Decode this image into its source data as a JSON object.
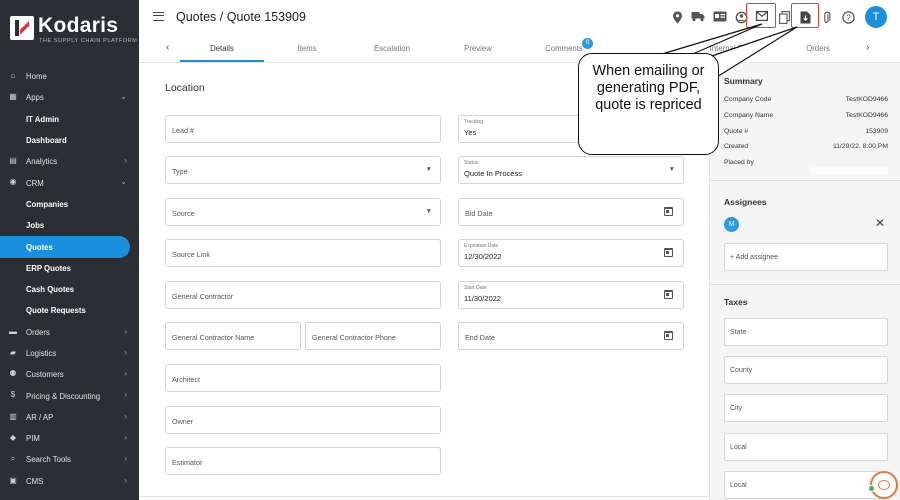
{
  "brand": {
    "name": "Kodaris",
    "tagline": "THE SUPPLY CHAIN PLATFORM"
  },
  "sidebar": {
    "items": [
      {
        "label": "Home",
        "icon": "home-icon",
        "glyph": "⌂",
        "has_chevron": false,
        "sub": false
      },
      {
        "label": "Apps",
        "icon": "apps-grid-icon",
        "glyph": "▦",
        "has_chevron": true,
        "chevron": "⌄",
        "sub": false
      },
      {
        "label": "IT Admin",
        "sub": true
      },
      {
        "label": "Dashboard",
        "sub": true
      },
      {
        "label": "Analytics",
        "icon": "analytics-icon",
        "glyph": "▤",
        "has_chevron": true,
        "chevron": "›",
        "sub": false
      },
      {
        "label": "CRM",
        "icon": "crm-icon",
        "glyph": "◉",
        "has_chevron": true,
        "chevron": "⌄",
        "sub": false
      },
      {
        "label": "Companies",
        "sub": true
      },
      {
        "label": "Jobs",
        "sub": true
      },
      {
        "label": "Quotes",
        "sub": true,
        "active": true
      },
      {
        "label": "ERP Quotes",
        "sub": true
      },
      {
        "label": "Cash Quotes",
        "sub": true
      },
      {
        "label": "Quote Requests",
        "sub": true
      },
      {
        "label": "Orders",
        "icon": "orders-icon",
        "glyph": "▬",
        "has_chevron": true,
        "chevron": "›",
        "sub": false
      },
      {
        "label": "Logistics",
        "icon": "truck-icon",
        "glyph": "▰",
        "has_chevron": true,
        "chevron": "›",
        "sub": false
      },
      {
        "label": "Customers",
        "icon": "people-icon",
        "glyph": "⚉",
        "has_chevron": true,
        "chevron": "›",
        "sub": false
      },
      {
        "label": "Pricing & Discounting",
        "icon": "dollar-icon",
        "glyph": "$",
        "has_chevron": true,
        "chevron": "›",
        "sub": false
      },
      {
        "label": "AR / AP",
        "icon": "bank-icon",
        "glyph": "▥",
        "has_chevron": true,
        "chevron": "›",
        "sub": false
      },
      {
        "label": "PIM",
        "icon": "tag-icon",
        "glyph": "◆",
        "has_chevron": true,
        "chevron": "›",
        "sub": false
      },
      {
        "label": "Search Tools",
        "icon": "search-icon",
        "glyph": "⌕",
        "has_chevron": true,
        "chevron": "›",
        "sub": false
      },
      {
        "label": "CMS",
        "icon": "cms-icon",
        "glyph": "▣",
        "has_chevron": true,
        "chevron": "›",
        "sub": false
      }
    ]
  },
  "header": {
    "title": "Quotes / Quote 153909",
    "avatar_initial": "T",
    "icons": [
      {
        "name": "location-pin-icon",
        "glyph": "⬤"
      },
      {
        "name": "truck-icon",
        "glyph": "⛟"
      },
      {
        "name": "id-card-icon",
        "glyph": "▣"
      },
      {
        "name": "sync-user-icon",
        "glyph": "⟳"
      },
      {
        "name": "email-icon",
        "glyph": "✉"
      },
      {
        "name": "copy-icon",
        "glyph": "❐"
      },
      {
        "name": "pdf-download-icon",
        "glyph": "⬇"
      },
      {
        "name": "attachment-icon",
        "glyph": "⌇"
      },
      {
        "name": "help-icon",
        "glyph": "?"
      }
    ]
  },
  "tabs": {
    "items": [
      "Details",
      "Items",
      "Escalation",
      "Preview",
      "Comments",
      "Internal Files",
      "Orders"
    ],
    "active": "Details",
    "comments_badge": "0",
    "prev_arrow": "‹",
    "next_arrow": "›"
  },
  "form": {
    "section_title": "Location",
    "lead": "Lead #",
    "type": "Type",
    "source": "Source",
    "source_link": "Source Link",
    "general_contractor": "General Contractor",
    "gc_name": "General Contractor Name",
    "gc_phone": "General Contractor Phone",
    "architect": "Architect",
    "owner": "Owner",
    "estimator": "Estimator",
    "tracking": {
      "label": "Tracking",
      "value": "Yes"
    },
    "status": {
      "label": "Status",
      "value": "Quote In Process"
    },
    "bid_date": "Bid Date",
    "expiration": {
      "label": "Expiration Date",
      "value": "12/30/2022"
    },
    "start": {
      "label": "Start Date",
      "value": "11/30/2022"
    },
    "end_date": "End Date"
  },
  "summary": {
    "title": "Summary",
    "rows": [
      {
        "label": "Company Code",
        "value": "TestKOD9466"
      },
      {
        "label": "Company Name",
        "value": "TestKOD9466"
      },
      {
        "label": "Quote #",
        "value": "153909"
      },
      {
        "label": "Created",
        "value": "11/29/22, 8:00 PM"
      },
      {
        "label": "Placed by",
        "value": ""
      }
    ]
  },
  "assignees": {
    "title": "Assignees",
    "initial": "M",
    "add_placeholder": "+ Add assignee",
    "close": "✕"
  },
  "taxes": {
    "title": "Taxes",
    "fields": [
      "State",
      "County",
      "City",
      "Local",
      "Local"
    ]
  },
  "callout": {
    "text": "When emailing or generating PDF, quote is repriced"
  },
  "colors": {
    "accent": "#1a8fdc",
    "sidebar": "#2b2e33",
    "highlight": "#d9423a"
  }
}
